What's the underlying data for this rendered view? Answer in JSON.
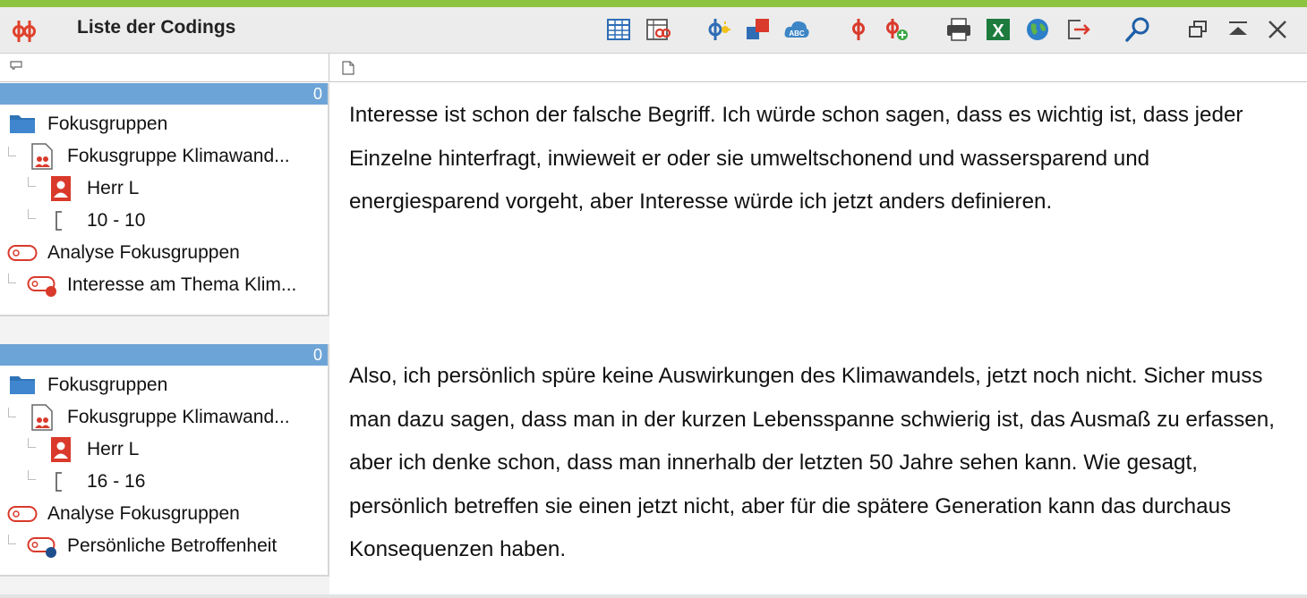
{
  "window": {
    "title": "Liste der Codings"
  },
  "toolbar": {
    "buttons": [
      {
        "name": "table-view-icon"
      },
      {
        "name": "code-table-icon"
      },
      {
        "name": "code-suggest-icon"
      },
      {
        "name": "color-swatch-icon"
      },
      {
        "name": "abc-cloud-icon"
      },
      {
        "name": "code-pin-icon"
      },
      {
        "name": "code-add-icon"
      },
      {
        "name": "print-icon"
      },
      {
        "name": "excel-export-icon"
      },
      {
        "name": "web-export-icon"
      },
      {
        "name": "export-icon"
      },
      {
        "name": "search-icon"
      },
      {
        "name": "restore-window-icon"
      },
      {
        "name": "collapse-icon"
      },
      {
        "name": "close-icon"
      }
    ]
  },
  "codings": [
    {
      "count": "0",
      "folder": "Fokusgruppen",
      "document": "Fokusgruppe Klimawand...",
      "speaker": "Herr L",
      "range": "10 - 10",
      "code_system": "Analyse Fokusgruppen",
      "code": "Interesse am Thema Klim...",
      "code_color": "#d93a2b",
      "text": "Interesse ist schon der falsche Begriff. Ich würde schon sagen, dass es wichtig ist, dass jeder Einzelne hinterfragt, inwieweit er oder sie umweltschonend und wassersparend und energiesparend vorgeht, aber Interesse würde ich jetzt anders definieren."
    },
    {
      "count": "0",
      "folder": "Fokusgruppen",
      "document": "Fokusgruppe Klimawand...",
      "speaker": "Herr L",
      "range": "16 - 16",
      "code_system": "Analyse Fokusgruppen",
      "code": "Persönliche Betroffenheit",
      "code_color": "#1f4e8c",
      "text": "Also, ich persönlich spüre keine Auswirkungen des Klimawandels, jetzt noch nicht. Sicher muss man dazu sagen, dass man in der kurzen Lebensspanne schwierig ist, das Ausmaß zu erfassen, aber ich denke schon, dass man innerhalb der letzten 50 Jahre sehen kann. Wie gesagt, persönlich betreffen sie einen jetzt nicht, aber für die spätere Generation kann das durchaus Konsequenzen haben."
    }
  ],
  "colors": {
    "accent_stripe": "#8cc33f",
    "selection_bar": "#6da4d7",
    "brand_red": "#d93a2b"
  }
}
